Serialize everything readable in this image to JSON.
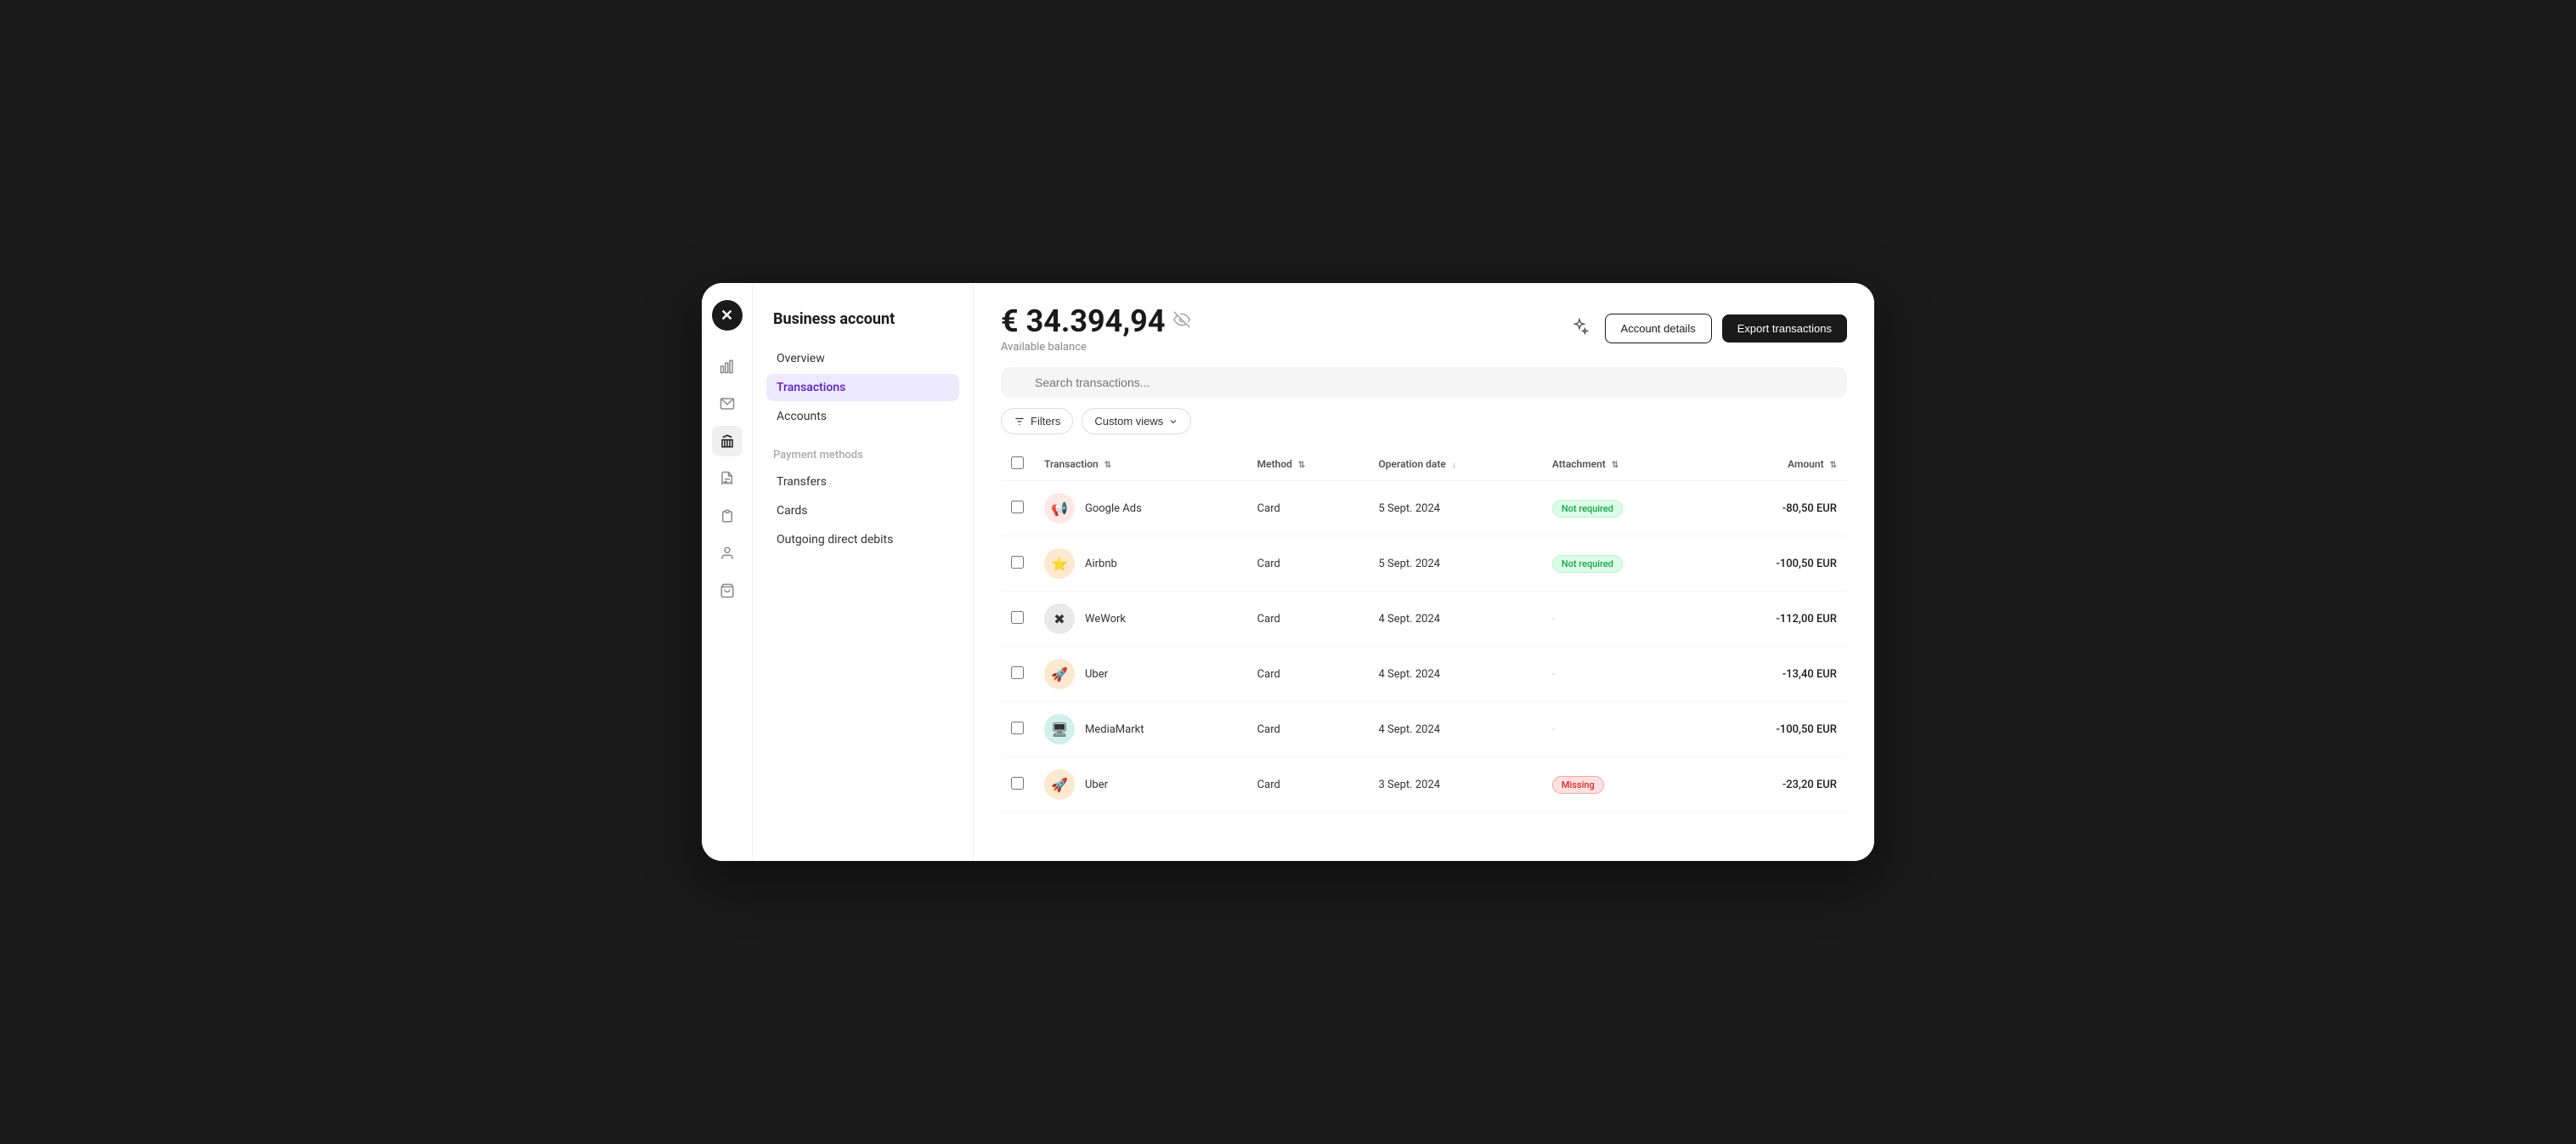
{
  "app": {
    "logo": "✕",
    "title": "Business account"
  },
  "nav": {
    "icons": [
      {
        "id": "chart-icon",
        "symbol": "📊",
        "active": false
      },
      {
        "id": "mail-icon",
        "symbol": "✉",
        "active": false
      },
      {
        "id": "bank-icon",
        "symbol": "🏦",
        "active": true
      },
      {
        "id": "receipt-icon",
        "symbol": "📋",
        "active": false
      },
      {
        "id": "invoice-icon",
        "symbol": "🧾",
        "active": false
      },
      {
        "id": "person-icon",
        "symbol": "👤",
        "active": false
      },
      {
        "id": "bag-icon",
        "symbol": "💼",
        "active": false
      }
    ]
  },
  "sidebar": {
    "business_account": "Business account",
    "overview_label": "Overview",
    "nav_items": [
      {
        "id": "transactions",
        "label": "Transactions",
        "active": true
      },
      {
        "id": "accounts",
        "label": "Accounts",
        "active": false
      }
    ],
    "payment_methods_title": "Payment methods",
    "payment_items": [
      {
        "id": "transfers",
        "label": "Transfers",
        "active": false
      },
      {
        "id": "cards",
        "label": "Cards",
        "active": false
      },
      {
        "id": "direct-debits",
        "label": "Outgoing direct debits",
        "active": false
      }
    ]
  },
  "header": {
    "balance_amount": "€ 34.394,94",
    "balance_label": "Available balance",
    "btn_account_details": "Account details",
    "btn_export": "Export transactions"
  },
  "search": {
    "placeholder": "Search transactions..."
  },
  "filters": {
    "filters_label": "Filters",
    "custom_views_label": "Custom views"
  },
  "table": {
    "columns": [
      {
        "id": "transaction",
        "label": "Transaction",
        "sortable": true
      },
      {
        "id": "method",
        "label": "Method",
        "sortable": true
      },
      {
        "id": "operation_date",
        "label": "Operation date",
        "sortable": true,
        "sort_active": true
      },
      {
        "id": "attachment",
        "label": "Attachment",
        "sortable": true
      },
      {
        "id": "amount",
        "label": "Amount",
        "sortable": true
      }
    ],
    "rows": [
      {
        "id": 1,
        "merchant": "Google Ads",
        "icon_symbol": "📢",
        "icon_class": "pink",
        "method": "Card",
        "date": "5 Sept. 2024",
        "attachment": "Not required",
        "attachment_type": "not-required",
        "amount": "-80,50 EUR"
      },
      {
        "id": 2,
        "merchant": "Airbnb",
        "icon_symbol": "⭐",
        "icon_class": "orange",
        "method": "Card",
        "date": "5 Sept. 2024",
        "attachment": "Not required",
        "attachment_type": "not-required",
        "amount": "-100,50 EUR"
      },
      {
        "id": 3,
        "merchant": "WeWork",
        "icon_symbol": "✖",
        "icon_class": "gray",
        "method": "Card",
        "date": "4 Sept. 2024",
        "attachment": "-",
        "attachment_type": "dash",
        "amount": "-112,00 EUR"
      },
      {
        "id": 4,
        "merchant": "Uber",
        "icon_symbol": "🚀",
        "icon_class": "orange",
        "method": "Card",
        "date": "4 Sept. 2024",
        "attachment": "-",
        "attachment_type": "dash",
        "amount": "-13,40 EUR"
      },
      {
        "id": 5,
        "merchant": "MediaMarkt",
        "icon_symbol": "🖥",
        "icon_class": "teal",
        "method": "Card",
        "date": "4 Sept. 2024",
        "attachment": "-",
        "attachment_type": "dash",
        "amount": "-100,50 EUR"
      },
      {
        "id": 6,
        "merchant": "Uber",
        "icon_symbol": "🚀",
        "icon_class": "orange",
        "method": "Card",
        "date": "3 Sept. 2024",
        "attachment": "Missing",
        "attachment_type": "missing",
        "amount": "-23,20 EUR"
      }
    ]
  }
}
